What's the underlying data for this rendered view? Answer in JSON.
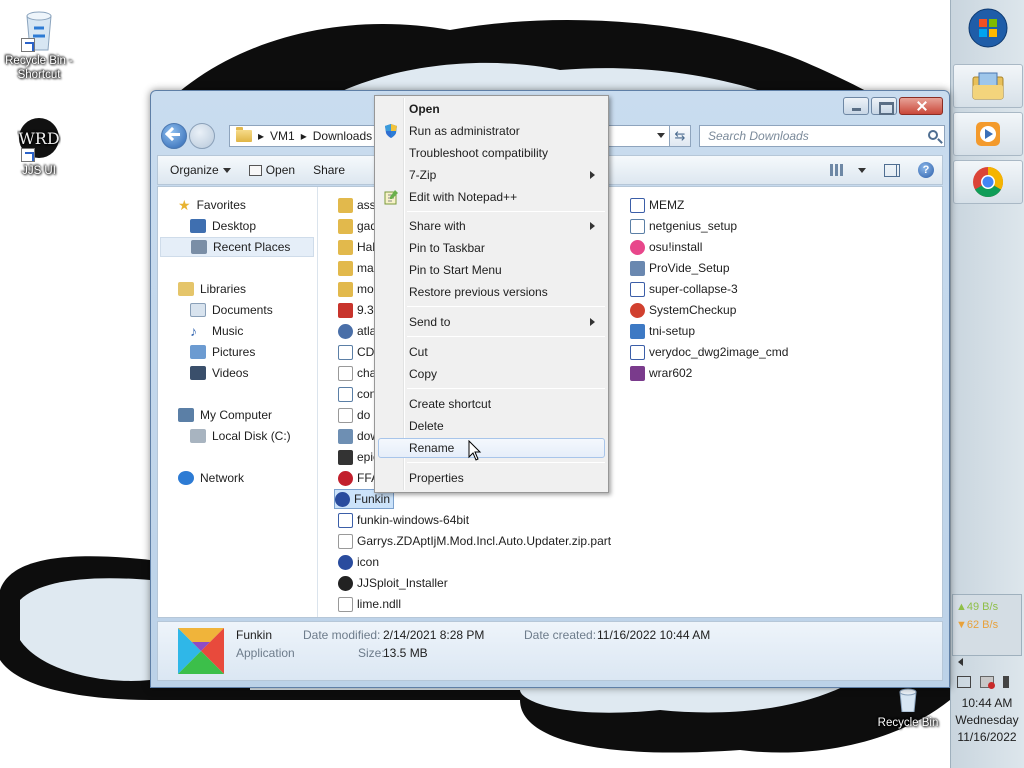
{
  "desktop": {
    "icons": [
      {
        "label_line1": "Recycle Bin -",
        "label_line2": "Shortcut"
      },
      {
        "label": "JJS UI"
      },
      {
        "label": "Recycle Bin"
      }
    ]
  },
  "window": {
    "address": {
      "segment1": "VM1",
      "segment2": "Downloads"
    },
    "search_placeholder": "Search Downloads",
    "toolbar": {
      "organize": "Organize",
      "open": "Open",
      "share": "Share"
    }
  },
  "navpane": {
    "favorites": "Favorites",
    "desktop": "Desktop",
    "recent_places": "Recent Places",
    "libraries": "Libraries",
    "documents": "Documents",
    "music": "Music",
    "pictures": "Pictures",
    "videos": "Videos",
    "my_computer": "My Computer",
    "local_disk": "Local Disk (C:)",
    "network": "Network"
  },
  "files_col1": [
    {
      "name": "asse",
      "icon": "folder-icon",
      "color": "#e2b94c"
    },
    {
      "name": "gad",
      "icon": "folder-icon",
      "color": "#e2b94c"
    },
    {
      "name": "Half",
      "icon": "folder-icon",
      "color": "#e2b94c"
    },
    {
      "name": "mar",
      "icon": "folder-icon",
      "color": "#e2b94c"
    },
    {
      "name": "mod",
      "icon": "folder-icon",
      "color": "#e2b94c"
    },
    {
      "name": "9.3.3",
      "icon": "pdf-icon",
      "color": "#c8342c"
    },
    {
      "name": "atla",
      "icon": "app-icon",
      "color": "#4a6fa8"
    },
    {
      "name": "CDL",
      "icon": "download-icon",
      "color": "#5b7fa6"
    },
    {
      "name": "cha",
      "icon": "file-icon",
      "color": "#ffffff"
    },
    {
      "name": "con",
      "icon": "download-icon",
      "color": "#5b7fa6"
    },
    {
      "name": "do N",
      "icon": "file-icon",
      "color": "#ffffff"
    },
    {
      "name": "dow",
      "icon": "image-icon",
      "color": "#6e8fb3"
    },
    {
      "name": "epic",
      "icon": "app-icon",
      "color": "#333333"
    },
    {
      "name": "FFA",
      "icon": "app-icon",
      "color": "#c21f2c"
    },
    {
      "name": "Funkin",
      "icon": "funkin-icon",
      "color": "#2a4c9e"
    },
    {
      "name": "funkin-windows-64bit",
      "icon": "zip-icon",
      "color": "#3b5ea8"
    },
    {
      "name": "Garrys.ZDAptIjM.Mod.Incl.Auto.Updater.zip.part",
      "icon": "file-icon",
      "color": "#ffffff"
    },
    {
      "name": "icon",
      "icon": "funkin-icon",
      "color": "#2a4c9e"
    },
    {
      "name": "JJSploit_Installer",
      "icon": "app-icon",
      "color": "#222222"
    },
    {
      "name": "lime.ndll",
      "icon": "file-icon",
      "color": "#ffffff"
    }
  ],
  "files_col2": [
    {
      "name": "MEMZ",
      "icon": "zip-icon",
      "color": "#3b5ea8"
    },
    {
      "name": "netgenius_setup",
      "icon": "download-icon",
      "color": "#5b7fa6"
    },
    {
      "name": "osu!install",
      "icon": "osu-icon",
      "color": "#e8478b"
    },
    {
      "name": "ProVide_Setup",
      "icon": "setup-icon",
      "color": "#6a88b0"
    },
    {
      "name": "super-collapse-3",
      "icon": "zip-icon",
      "color": "#3b5ea8"
    },
    {
      "name": "SystemCheckup",
      "icon": "app-icon",
      "color": "#d1402f"
    },
    {
      "name": "tni-setup",
      "icon": "setup-icon",
      "color": "#3d79c4"
    },
    {
      "name": "verydoc_dwg2image_cmd",
      "icon": "zip-icon",
      "color": "#3b5ea8"
    },
    {
      "name": "wrar602",
      "icon": "rar-icon",
      "color": "#7a3b8c"
    }
  ],
  "details": {
    "name": "Funkin",
    "type": "Application",
    "modified_label": "Date modified:",
    "modified_value": "2/14/2021 8:28 PM",
    "size_label": "Size:",
    "size_value": "13.5 MB",
    "created_label": "Date created:",
    "created_value": "11/16/2022 10:44 AM"
  },
  "context_menu": {
    "open": "Open",
    "run_as_admin": "Run as administrator",
    "troubleshoot": "Troubleshoot compatibility",
    "zip": "7-Zip",
    "notepadpp": "Edit with Notepad++",
    "share_with": "Share with",
    "pin_taskbar": "Pin to Taskbar",
    "pin_start": "Pin to Start Menu",
    "restore": "Restore previous versions",
    "send_to": "Send to",
    "cut": "Cut",
    "copy": "Copy",
    "create_shortcut": "Create shortcut",
    "delete": "Delete",
    "rename": "Rename",
    "properties": "Properties"
  },
  "sidebar": {
    "net_up": "▲49 B/s",
    "net_down": "▼62 B/s",
    "time": "10:44 AM",
    "day": "Wednesday",
    "date": "11/16/2022"
  },
  "colors": {
    "accent": "#3b6cb4",
    "selection": "#cce3fa",
    "menu_highlight": "#a8c5ea"
  }
}
